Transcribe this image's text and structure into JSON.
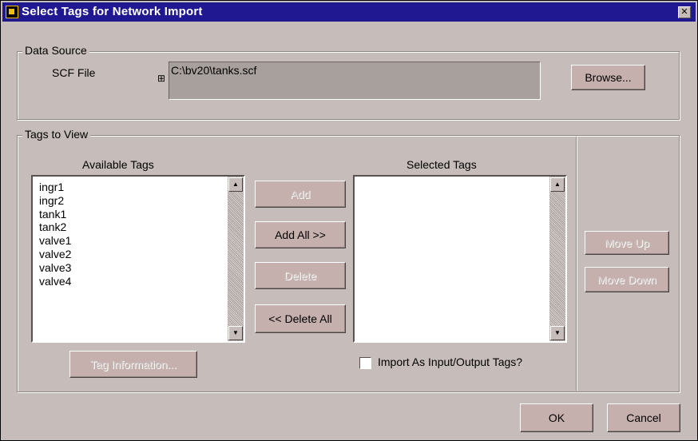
{
  "window": {
    "title": "Select Tags for Network Import",
    "close_glyph": "✕"
  },
  "data_source": {
    "group_label": "Data Source",
    "scf_label": "SCF File",
    "file_icon_glyph": "⊞",
    "scf_value": "C:\\bv20\\tanks.scf",
    "browse_label": "Browse..."
  },
  "tags_to_view": {
    "group_label": "Tags to View",
    "available_label": "Available Tags",
    "available_items": [
      "ingr1",
      "ingr2",
      "tank1",
      "tank2",
      "valve1",
      "valve2",
      "valve3",
      "valve4"
    ],
    "selected_label": "Selected Tags",
    "add_label": "Add",
    "add_all_label": "Add All >>",
    "delete_label": "Delete",
    "delete_all_label": "<< Delete All",
    "tag_info_label": "Tag Information...",
    "import_io_label": "Import As Input/Output Tags?",
    "move_up_label": "Move Up",
    "move_down_label": "Move Down"
  },
  "footer": {
    "ok_label": "OK",
    "cancel_label": "Cancel"
  },
  "scroll": {
    "up_glyph": "▲",
    "down_glyph": "▼"
  }
}
